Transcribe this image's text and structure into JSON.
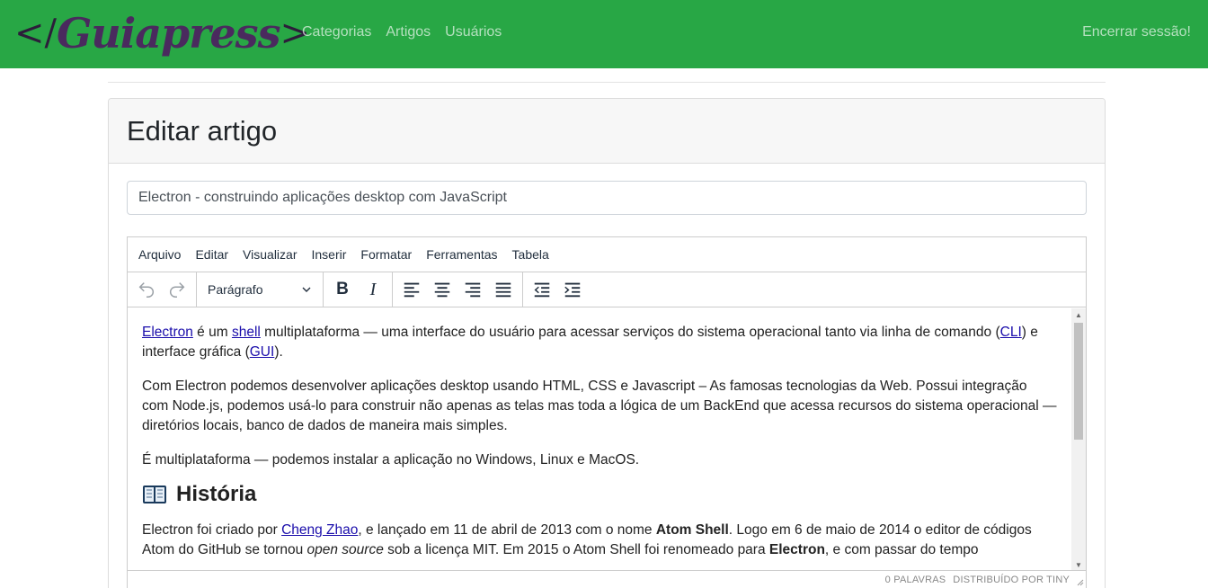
{
  "navbar": {
    "brand_open": "</",
    "brand_name": "Guiapress",
    "brand_close": ">",
    "links": [
      "Categorias",
      "Artigos",
      "Usuários"
    ],
    "logout": "Encerrar sessão!",
    "color": "#28a745"
  },
  "card": {
    "title": "Editar artigo"
  },
  "form": {
    "title_value": "Electron - construindo aplicações desktop com JavaScript"
  },
  "editor": {
    "menu": [
      "Arquivo",
      "Editar",
      "Visualizar",
      "Inserir",
      "Formatar",
      "Ferramentas",
      "Tabela"
    ],
    "block_format": "Parágrafo",
    "toolbar_icons": [
      "undo-icon",
      "redo-icon",
      "bold-icon",
      "italic-icon",
      "align-left-icon",
      "align-center-icon",
      "align-right-icon",
      "align-justify-icon",
      "outdent-icon",
      "indent-icon"
    ],
    "content": {
      "p1": {
        "link_electron": "Electron",
        "t1": " é um ",
        "link_shell": "shell",
        "t2": " multiplataforma — uma interface do usuário para acessar serviços do sistema operacional tanto via linha de comando (",
        "link_cli": "CLI",
        "t3": ") e interface gráfica (",
        "link_gui": "GUI",
        "t4": ")."
      },
      "p2": "Com Electron podemos desenvolver aplicações desktop usando HTML, CSS e Javascript – As famosas tecnologias da Web. Possui integração com Node.js, podemos usá-lo para construir não apenas as telas mas toda a lógica de um BackEnd que acessa recursos do sistema operacional — diretórios locais, banco de dados de maneira mais simples.",
      "p3": "É multiplataforma — podemos instalar a aplicação no Windows, Linux e MacOS.",
      "heading": "História",
      "p4": {
        "t1": "Electron foi criado por ",
        "link_cheng": "Cheng Zhao",
        "t2": ", e lançado em 11 de abril de 2013 com o nome ",
        "b1": "Atom Shell",
        "t3": ". Logo em 6 de maio de 2014 o editor de códigos Atom do GitHub se tornou ",
        "i1": "open source",
        "t4": " sob a licença MIT. Em 2015 o Atom Shell foi renomeado para ",
        "b2": "Electron",
        "t5": ", e com passar do tempo"
      }
    },
    "status_words": "0 PALAVRAS",
    "status_powered": "DISTRIBUÍDO POR TINY"
  }
}
